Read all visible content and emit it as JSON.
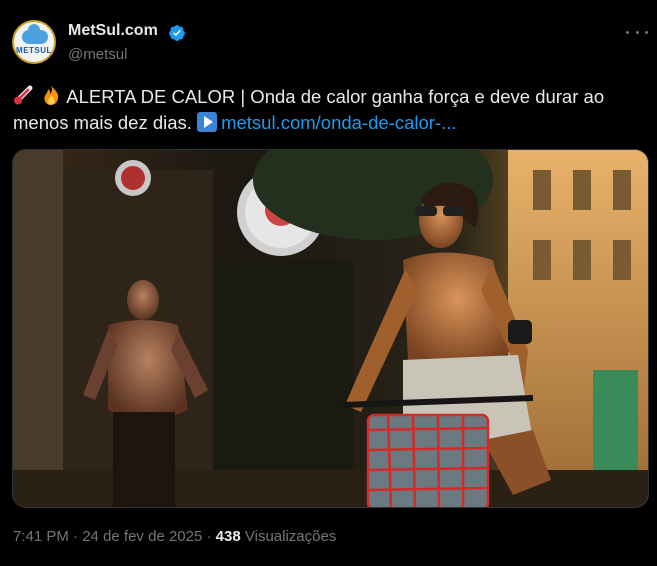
{
  "account": {
    "display_name": "MetSul.com",
    "handle": "@metsul",
    "avatar_text": "METSUL",
    "verified": true
  },
  "tweet": {
    "emojis": [
      "thermometer-emoji",
      "fire-emoji"
    ],
    "text": "ALERTA DE CALOR | Onda de calor ganha força e deve durar ao menos mais dez dias.",
    "link_text": "metsul.com/onda-de-calor-..."
  },
  "photo": {
    "alt": "Homem sem camisa de óculos escuros pedalando bicicleta com cesta vermelha; ao fundo, homem sem camisa correndo"
  },
  "footer": {
    "time": "7:41 PM",
    "separator": "·",
    "date": "24 de fev de 2025",
    "views_count": "438",
    "views_label": "Visualizações"
  },
  "colors": {
    "background": "#000000",
    "text": "#e7e9ea",
    "muted": "#71767b",
    "link": "#1d9bf0",
    "verified": "#1d9bf0"
  }
}
